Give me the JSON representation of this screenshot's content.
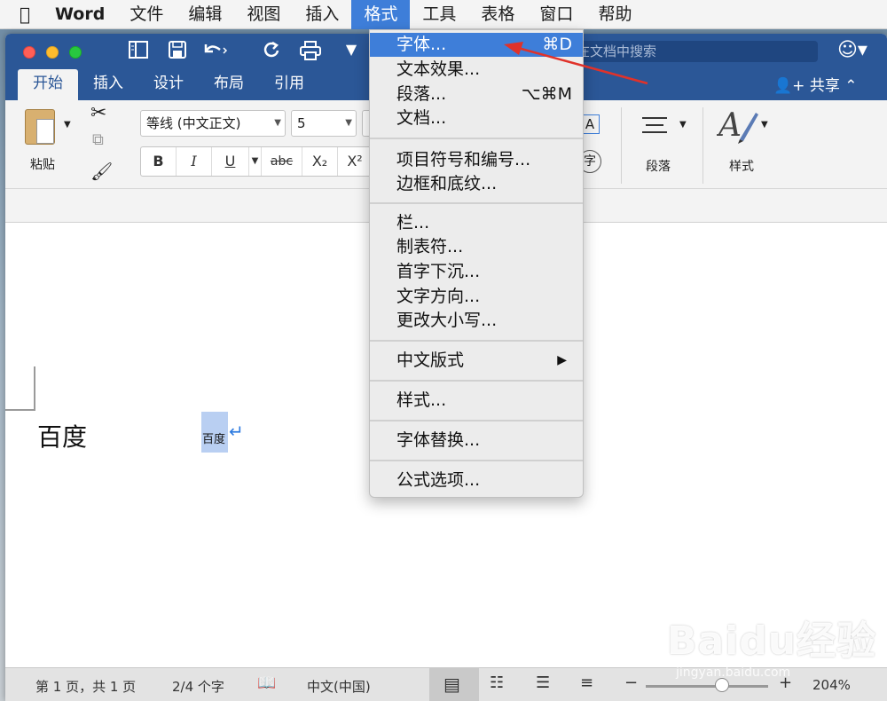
{
  "menubar": {
    "apple_icon": "apple-logo-icon",
    "items": [
      {
        "label": "Word"
      },
      {
        "label": "文件"
      },
      {
        "label": "编辑"
      },
      {
        "label": "视图"
      },
      {
        "label": "插入"
      },
      {
        "label": "格式"
      },
      {
        "label": "工具"
      },
      {
        "label": "表格"
      },
      {
        "label": "窗口"
      },
      {
        "label": "帮助"
      }
    ],
    "active": "格式"
  },
  "titlebar": {
    "search_placeholder": "在文档中搜索",
    "icons": [
      "sidebar-icon",
      "save-icon",
      "undo-icon",
      "redo-icon",
      "print-icon",
      "customize-icon",
      "smiley-icon"
    ]
  },
  "ribbon_tabs": [
    {
      "label": "开始"
    },
    {
      "label": "插入"
    },
    {
      "label": "设计"
    },
    {
      "label": "布局"
    },
    {
      "label": "引用"
    }
  ],
  "share_label": "共享",
  "ribbon": {
    "paste_label": "粘贴",
    "font_name": "等线 (中文正文)",
    "font_size": "5",
    "bold": "B",
    "italic": "I",
    "underline": "U",
    "strike": "abc",
    "subscript": "X₂",
    "superscript": "X²",
    "paragraph_label": "段落",
    "styles_label": "样式",
    "a_box": "A",
    "zi_circle": "字"
  },
  "format_menu": {
    "items": [
      {
        "label": "字体...",
        "shortcut": "⌘D",
        "highlight": true
      },
      {
        "label": "文本效果...",
        "shortcut": ""
      },
      {
        "label": "段落...",
        "shortcut": "⌥⌘M"
      },
      {
        "label": "文档...",
        "shortcut": ""
      },
      {
        "label": "项目符号和编号...",
        "shortcut": ""
      },
      {
        "label": "边框和底纹...",
        "shortcut": ""
      },
      {
        "label": "栏...",
        "shortcut": ""
      },
      {
        "label": "制表符...",
        "shortcut": ""
      },
      {
        "label": "首字下沉...",
        "shortcut": ""
      },
      {
        "label": "文字方向...",
        "shortcut": ""
      },
      {
        "label": "更改大小写...",
        "shortcut": ""
      },
      {
        "label": "中文版式",
        "submenu": true
      },
      {
        "label": "样式...",
        "shortcut": ""
      },
      {
        "label": "字体替换...",
        "shortcut": ""
      },
      {
        "label": "公式选项...",
        "shortcut": ""
      }
    ]
  },
  "document": {
    "large_text": "百度",
    "small_text": "百度",
    "para_mark": "↵"
  },
  "statusbar": {
    "page": "第 1 页，共 1 页",
    "words": "2/4 个字",
    "language": "中文(中国)",
    "zoom_minus": "−",
    "zoom_plus": "+",
    "zoom": "204%"
  },
  "watermark": {
    "main": "Baidu经验",
    "sub": "jingyan.baidu.com"
  },
  "colors": {
    "word_blue": "#2b5797",
    "menu_highlight": "#3e7ed9",
    "annotation_red": "#e0322a"
  }
}
